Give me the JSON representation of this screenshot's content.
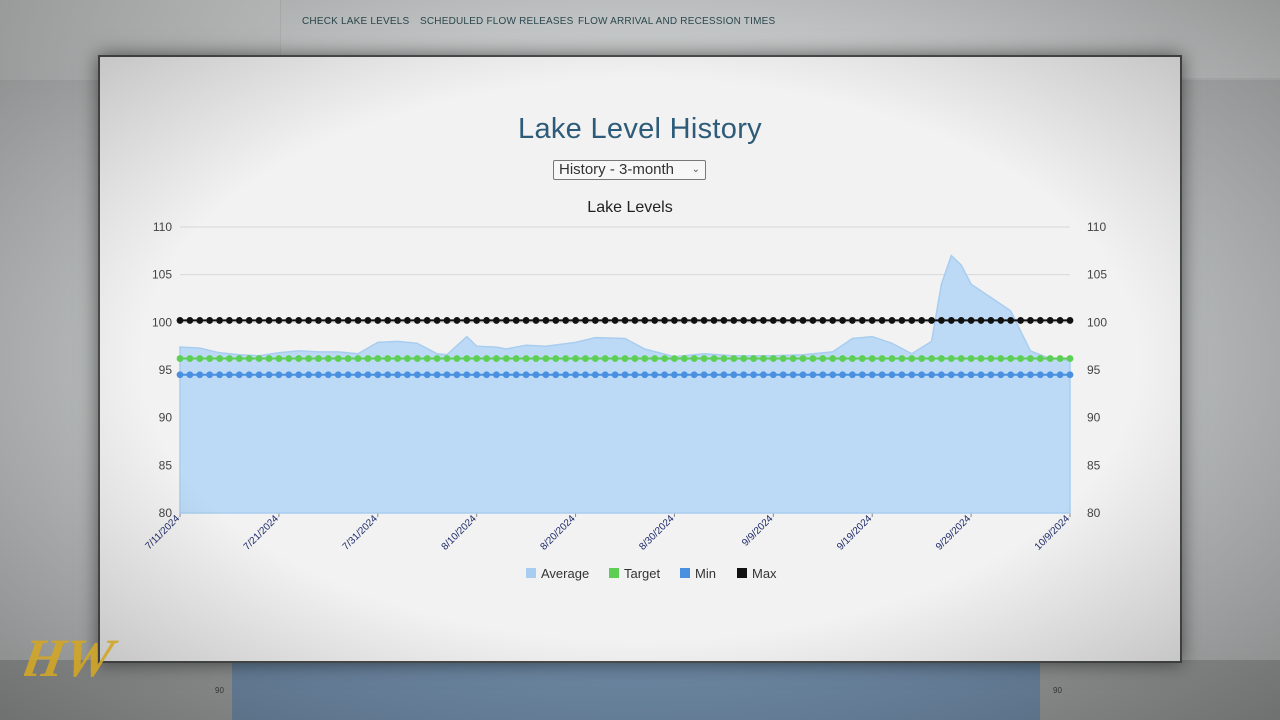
{
  "nav": {
    "items": [
      "CHECK LAKE LEVELS",
      "SCHEDULED FLOW RELEASES",
      "FLOW ARRIVAL AND RECESSION TIMES"
    ]
  },
  "page": {
    "title": "Lake Level History",
    "range_select": {
      "value": "History - 3-month"
    }
  },
  "background_chart": {
    "tick_left": "90",
    "tick_right": "90"
  },
  "watermark": {
    "text": "HW"
  },
  "colors": {
    "average": "#a9cdf0",
    "average_fill": "#bcdaf5",
    "target": "#5ecf55",
    "min": "#4a90e0",
    "max": "#111111",
    "title": "#2d5b79",
    "tick_label_x": "#1f2a6b"
  },
  "chart_data": {
    "type": "area",
    "title": "Lake Levels",
    "xlabel": "",
    "ylabel": "",
    "ylim": [
      80,
      110
    ],
    "yticks": [
      80,
      85,
      90,
      95,
      100,
      105,
      110
    ],
    "xlim": [
      "7/11/2024",
      "10/9/2024"
    ],
    "xtick_labels": [
      "7/11/2024",
      "7/21/2024",
      "7/31/2024",
      "8/10/2024",
      "8/20/2024",
      "8/30/2024",
      "9/9/2024",
      "9/19/2024",
      "9/29/2024",
      "10/9/2024"
    ],
    "grid": true,
    "legend": "bottom",
    "series": [
      {
        "name": "Average",
        "style": "area",
        "points": [
          [
            "7/11/2024",
            97.4
          ],
          [
            "7/13/2024",
            97.3
          ],
          [
            "7/15/2024",
            96.8
          ],
          [
            "7/17/2024",
            96.6
          ],
          [
            "7/19/2024",
            96.5
          ],
          [
            "7/21/2024",
            96.8
          ],
          [
            "7/23/2024",
            97.0
          ],
          [
            "7/25/2024",
            96.9
          ],
          [
            "7/27/2024",
            96.9
          ],
          [
            "7/29/2024",
            96.7
          ],
          [
            "7/31/2024",
            97.9
          ],
          [
            "8/2/2024",
            98.0
          ],
          [
            "8/4/2024",
            97.8
          ],
          [
            "8/6/2024",
            96.7
          ],
          [
            "8/7/2024",
            96.6
          ],
          [
            "8/9/2024",
            98.5
          ],
          [
            "8/10/2024",
            97.5
          ],
          [
            "8/12/2024",
            97.4
          ],
          [
            "8/13/2024",
            97.2
          ],
          [
            "8/15/2024",
            97.6
          ],
          [
            "8/17/2024",
            97.5
          ],
          [
            "8/20/2024",
            97.9
          ],
          [
            "8/22/2024",
            98.4
          ],
          [
            "8/25/2024",
            98.3
          ],
          [
            "8/27/2024",
            97.2
          ],
          [
            "8/30/2024",
            96.4
          ],
          [
            "9/2/2024",
            96.7
          ],
          [
            "9/5/2024",
            96.5
          ],
          [
            "9/9/2024",
            96.5
          ],
          [
            "9/12/2024",
            96.6
          ],
          [
            "9/15/2024",
            96.9
          ],
          [
            "9/17/2024",
            98.3
          ],
          [
            "9/19/2024",
            98.5
          ],
          [
            "9/21/2024",
            97.8
          ],
          [
            "9/23/2024",
            96.7
          ],
          [
            "9/25/2024",
            98.0
          ],
          [
            "9/26/2024",
            104.0
          ],
          [
            "9/27/2024",
            107.0
          ],
          [
            "9/28/2024",
            106.0
          ],
          [
            "9/29/2024",
            104.0
          ],
          [
            "10/1/2024",
            102.6
          ],
          [
            "10/3/2024",
            101.2
          ],
          [
            "10/5/2024",
            97.0
          ],
          [
            "10/7/2024",
            96.2
          ],
          [
            "10/9/2024",
            96.0
          ]
        ]
      },
      {
        "name": "Target",
        "style": "dotted-line",
        "value": 96.2
      },
      {
        "name": "Min",
        "style": "dotted-line",
        "value": 94.5
      },
      {
        "name": "Max",
        "style": "dotted-line",
        "value": 100.2
      }
    ]
  }
}
